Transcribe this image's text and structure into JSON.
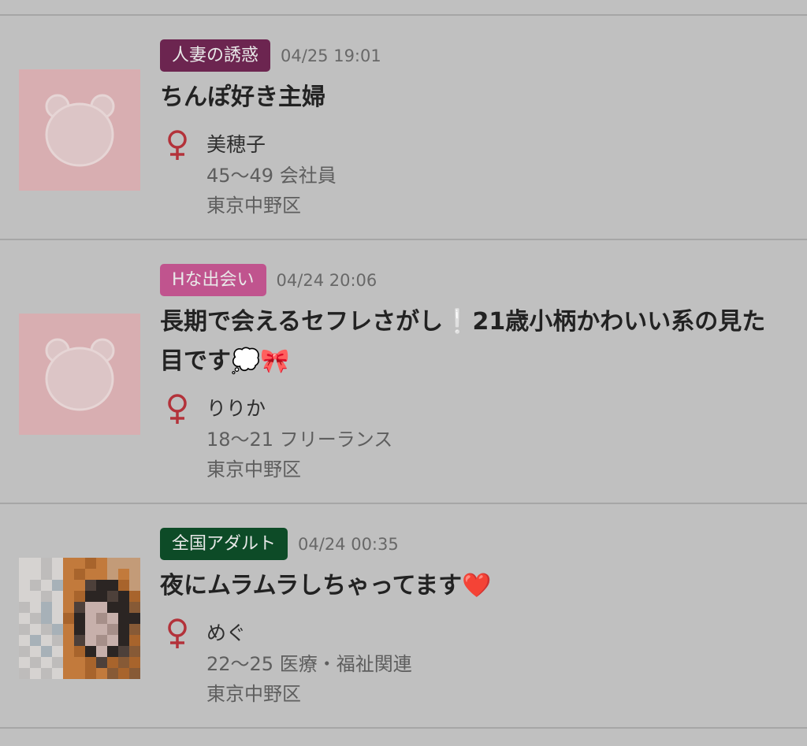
{
  "posts": [
    {
      "category": "人妻の誘惑",
      "category_color": "#6c2550",
      "date": "04/25 19:01",
      "title": "ちんぽ好き主婦",
      "gender": "female-icon",
      "name": "美穂子",
      "age_job": "45〜49 会社員",
      "location": "東京中野区",
      "thumbnail": "bear-placeholder-icon"
    },
    {
      "category": "Hな出会い",
      "category_color": "#c0548e",
      "date": "04/24 20:06",
      "title": "長期で会えるセフレさがし❕21歳小柄かわいい系の見た目です💭🎀",
      "gender": "female-icon",
      "name": "りりか",
      "age_job": "18〜21 フリーランス",
      "location": "東京中野区",
      "thumbnail": "bear-placeholder-icon"
    },
    {
      "category": "全国アダルト",
      "category_color": "#0d4b27",
      "date": "04/24 00:35",
      "title": "夜にムラムラしちゃってます❤️",
      "gender": "female-icon",
      "name": "めぐ",
      "age_job": "22〜25 医療・福祉関連",
      "location": "東京中野区",
      "thumbnail": "user-photo"
    }
  ],
  "gender_icon_color": "#b3323a"
}
